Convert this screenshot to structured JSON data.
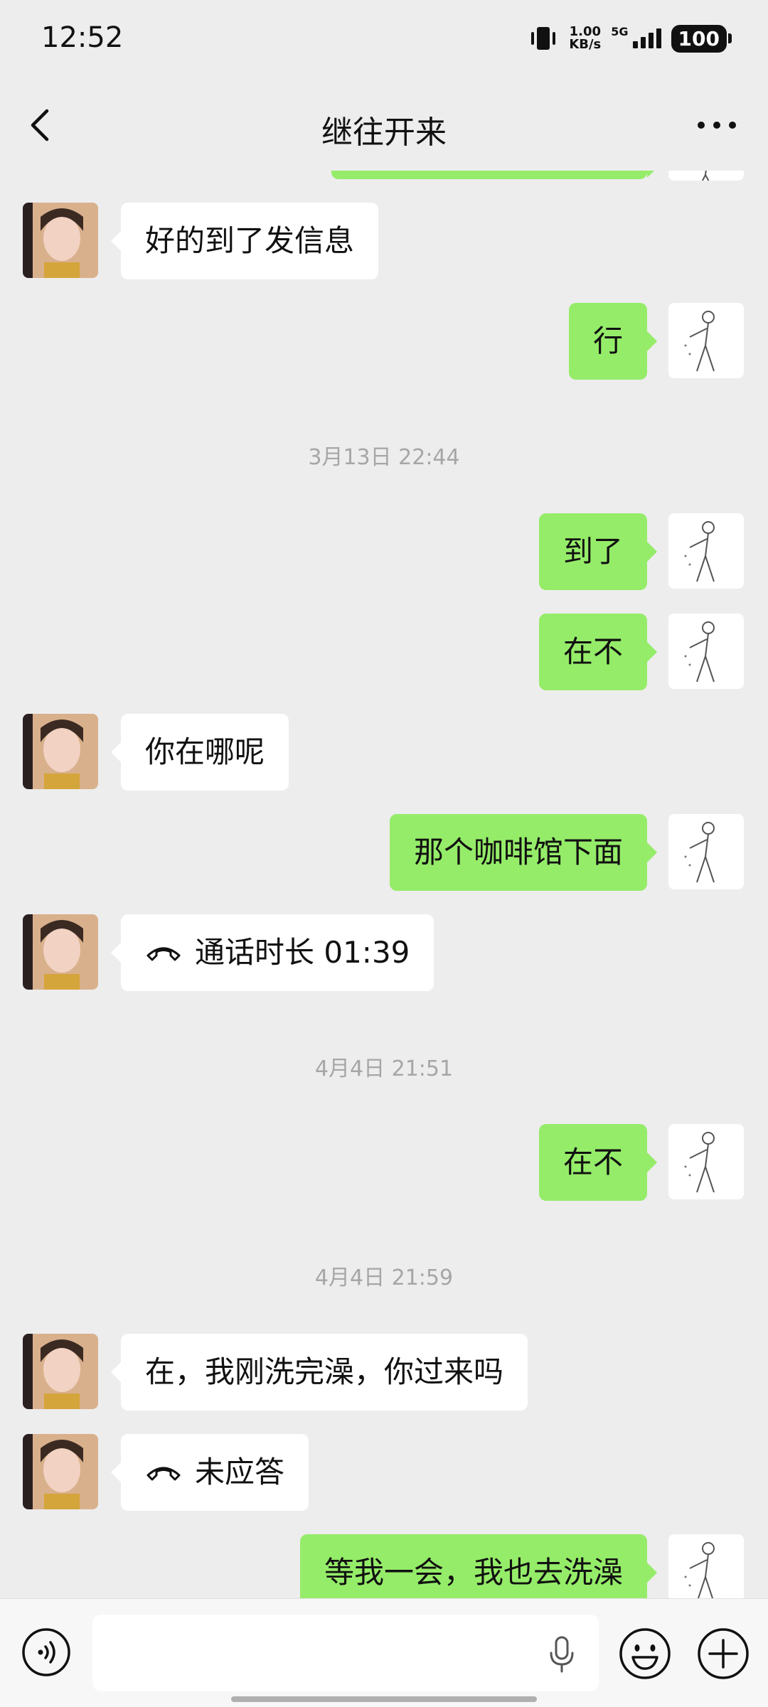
{
  "status_bar": {
    "time": "12:52",
    "net_speed_value": "1.00",
    "net_speed_unit": "KB/s",
    "network": "5G",
    "battery": "100"
  },
  "header": {
    "title": "继往开来"
  },
  "messages": [
    {
      "side": "in",
      "text": "好的到了发信息"
    },
    {
      "side": "out",
      "text": "行"
    },
    {
      "type": "time",
      "text": "3月13日 22:44"
    },
    {
      "side": "out",
      "text": "到了"
    },
    {
      "side": "out",
      "text": "在不"
    },
    {
      "side": "in",
      "text": "你在哪呢"
    },
    {
      "side": "out",
      "text": "那个咖啡馆下面"
    },
    {
      "side": "in",
      "type": "call",
      "text": "通话时长 01:39"
    },
    {
      "type": "time",
      "text": "4月4日 21:51"
    },
    {
      "side": "out",
      "text": "在不"
    },
    {
      "type": "time",
      "text": "4月4日 21:59"
    },
    {
      "side": "in",
      "text": "在，我刚洗完澡，你过来吗"
    },
    {
      "side": "in",
      "type": "call",
      "text": "未应答"
    },
    {
      "side": "out",
      "text": "等我一会，我也去洗澡"
    }
  ],
  "input": {
    "value": "",
    "placeholder": ""
  },
  "colors": {
    "outgoing_bubble": "#95ec69",
    "incoming_bubble": "#ffffff",
    "background": "#ededed"
  }
}
